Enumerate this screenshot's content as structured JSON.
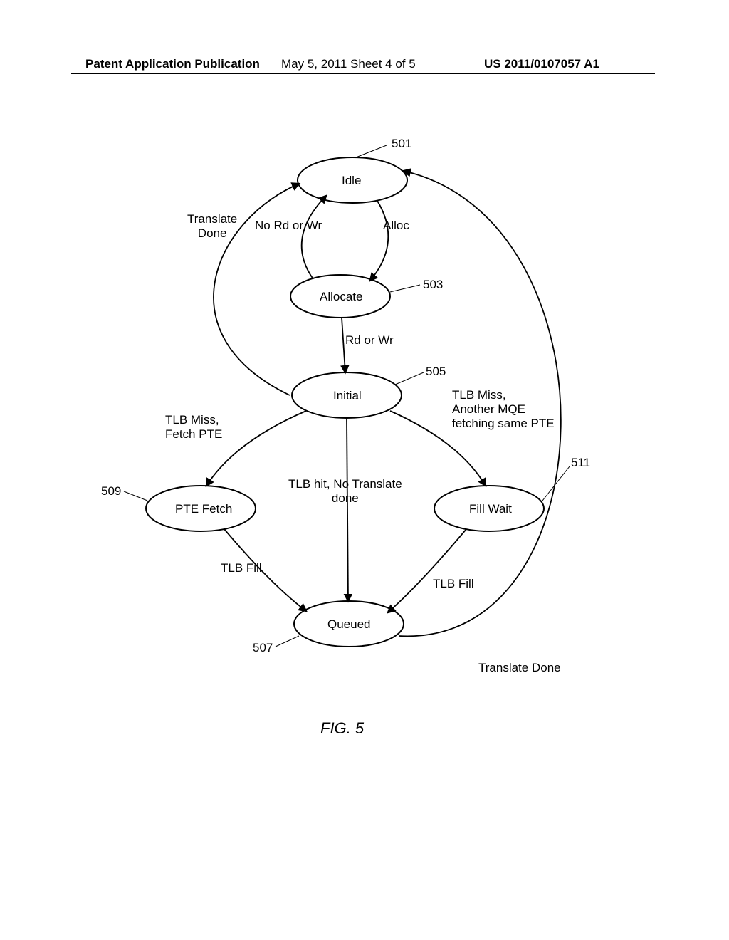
{
  "header": {
    "left": "Patent Application Publication",
    "center": "May 5, 2011  Sheet 4 of 5",
    "right": "US 2011/0107057 A1"
  },
  "states": {
    "idle": "Idle",
    "allocate": "Allocate",
    "initial": "Initial",
    "pte_fetch": "PTE Fetch",
    "fill_wait": "Fill Wait",
    "queued": "Queued"
  },
  "transitions": {
    "translate_done_left": "Translate\nDone",
    "no_rd_wr": "No Rd or Wr",
    "alloc": "Alloc",
    "rd_or_wr": "Rd or Wr",
    "tlb_miss_fetch": "TLB Miss,\nFetch PTE",
    "tlb_miss_another": "TLB Miss,\nAnother MQE\nfetching same PTE",
    "tlb_hit": "TLB hit, No Translate\ndone",
    "tlb_fill_left": "TLB Fill",
    "tlb_fill_right": "TLB Fill",
    "translate_done_bottom": "Translate Done"
  },
  "refs": {
    "r501": "501",
    "r503": "503",
    "r505": "505",
    "r507": "507",
    "r509": "509",
    "r511": "511"
  },
  "figure": "FIG. 5"
}
